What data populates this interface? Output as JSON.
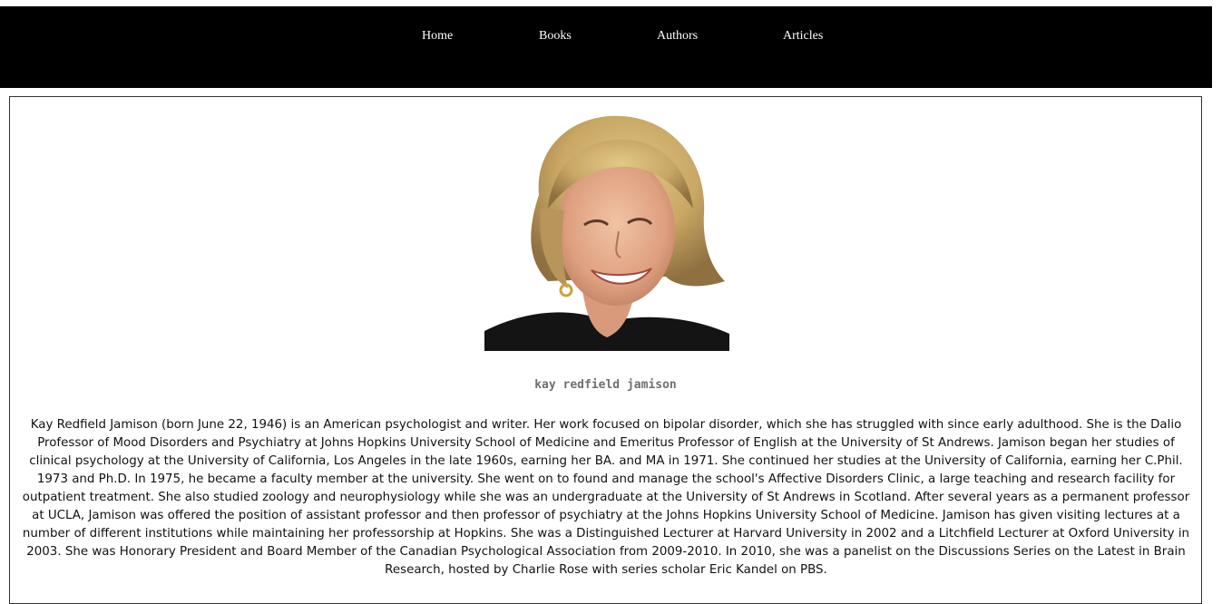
{
  "nav": {
    "items": [
      {
        "label": "Home"
      },
      {
        "label": "Books"
      },
      {
        "label": "Authors"
      },
      {
        "label": "Articles"
      }
    ]
  },
  "author": {
    "name": "kay redfield jamison",
    "bio": "Kay Redfield Jamison (born June 22, 1946) is an American psychologist and writer. Her work focused on bipolar disorder, which she has struggled with since early adulthood. She is the Dalio Professor of Mood Disorders and Psychiatry at Johns Hopkins University School of Medicine and Emeritus Professor of English at the University of St Andrews. Jamison began her studies of clinical psychology at the University of California, Los Angeles in the late 1960s, earning her BA. and MA in 1971. She continued her studies at the University of California, earning her C.Phil. 1973 and Ph.D. In 1975, he became a faculty member at the university. She went on to found and manage the school's Affective Disorders Clinic, a large teaching and research facility for outpatient treatment. She also studied zoology and neurophysiology while she was an undergraduate at the University of St Andrews in Scotland. After several years as a permanent professor at UCLA, Jamison was offered the position of assistant professor and then professor of psychiatry at the Johns Hopkins University School of Medicine. Jamison has given visiting lectures at a number of different institutions while maintaining her professorship at Hopkins. She was a Distinguished Lecturer at Harvard University in 2002 and a Litchfield Lecturer at Oxford University in 2003. She was Honorary President and Board Member of the Canadian Psychological Association from 2009-2010. In 2010, she was a panelist on the Discussions Series on the Latest in Brain Research, hosted by Charlie Rose with series scholar Eric Kandel on PBS."
  },
  "colors": {
    "header_bg": "#000000",
    "nav_text": "#ffffff",
    "caption": "#6f6f6f",
    "body_text": "#111111"
  }
}
